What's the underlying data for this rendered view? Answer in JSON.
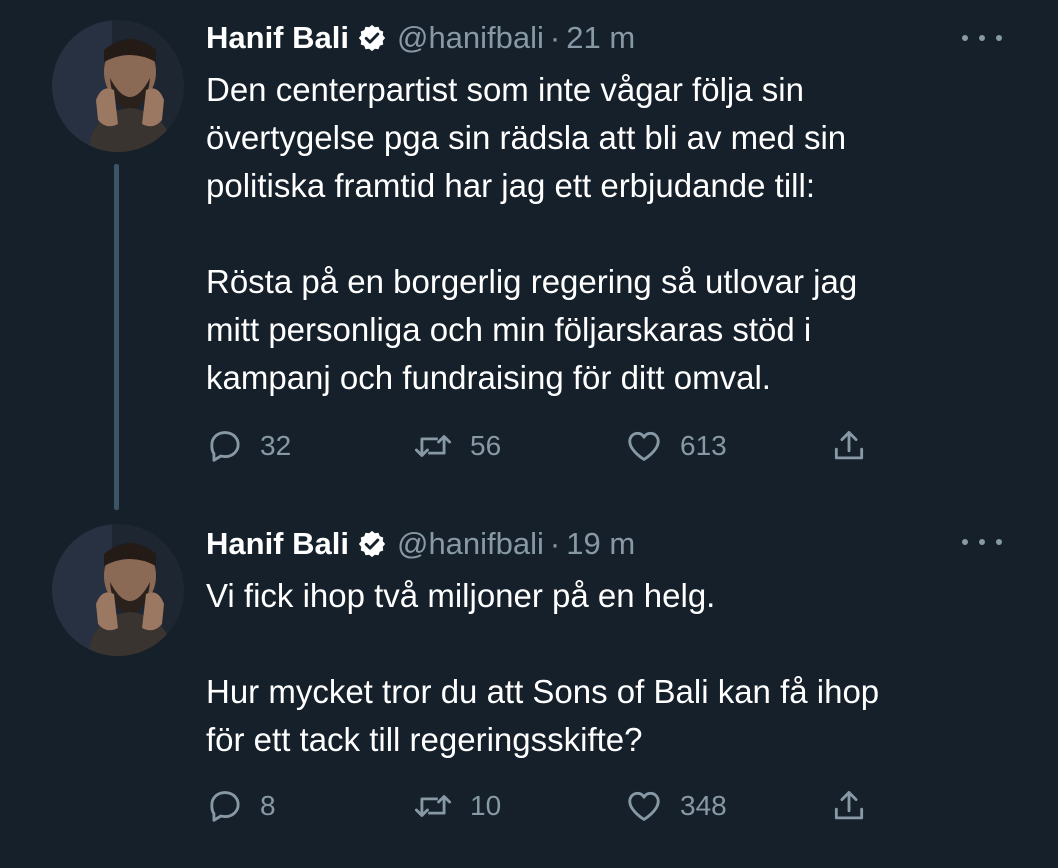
{
  "tweets": [
    {
      "author_name": "Hanif Bali",
      "handle": "@hanifbali",
      "separator": "·",
      "time": "21 m",
      "paragraphs": [
        "Den centerpartist som inte vågar följa sin",
        "övertygelse pga sin rädsla att bli av med sin",
        "politiska framtid har jag ett erbjudande till:",
        "",
        "Rösta på en borgerlig regering så utlovar jag",
        "mitt personliga och min följarskaras stöd i",
        "kampanj och fundraising för ditt omval."
      ],
      "stats": {
        "replies": "32",
        "retweets": "56",
        "likes": "613"
      }
    },
    {
      "author_name": "Hanif Bali",
      "handle": "@hanifbali",
      "separator": "·",
      "time": "19 m",
      "paragraphs": [
        "Vi fick ihop två miljoner på en helg.",
        "",
        "Hur mycket tror du att Sons of Bali kan få ihop",
        "för ett tack till regeringsskifte?"
      ],
      "stats": {
        "replies": "8",
        "retweets": "10",
        "likes": "348"
      }
    }
  ],
  "icons": {
    "reply": "reply-icon",
    "retweet": "retweet-icon",
    "like": "heart-icon",
    "share": "share-icon",
    "verified": "verified-badge-icon",
    "more": "more-options-icon"
  },
  "colors": {
    "background": "#15202b",
    "text_primary": "#ffffff",
    "text_secondary": "#8899a6",
    "thread_line": "#3d5466"
  }
}
